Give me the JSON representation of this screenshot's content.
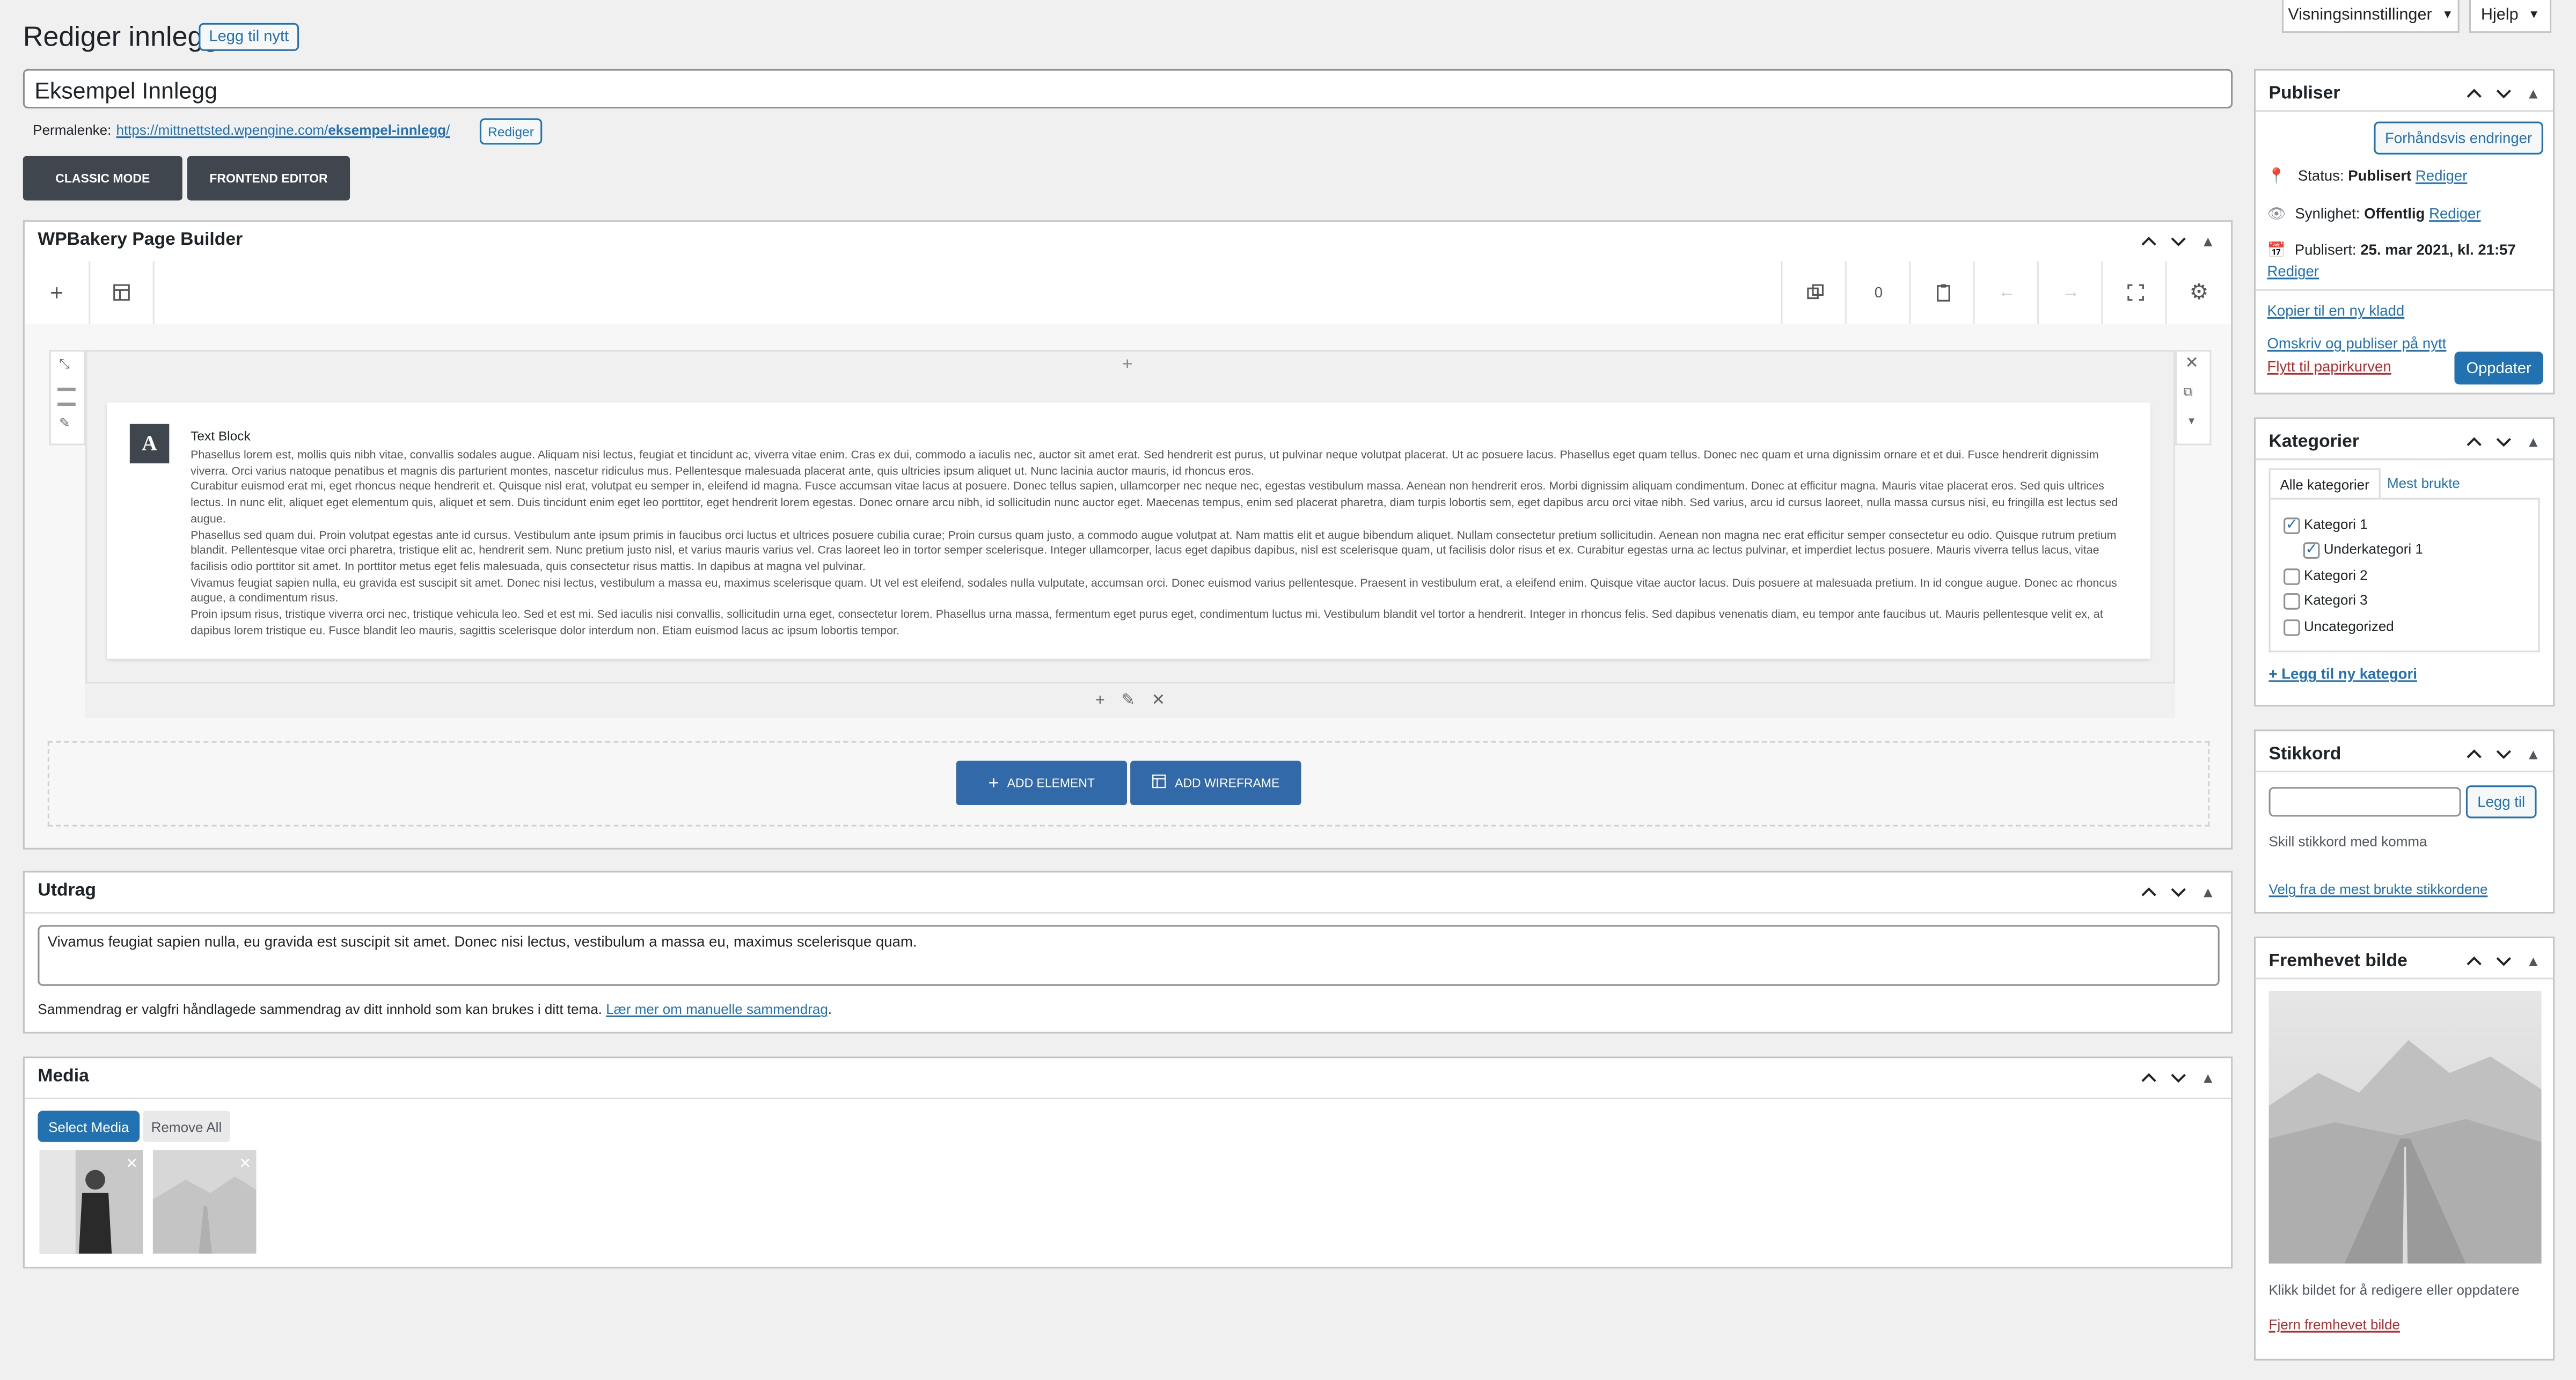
{
  "header": {
    "title": "Rediger innlegg",
    "add_new": "Legg til nytt",
    "screen_options": "Visningsinnstillinger",
    "help": "Hjelp"
  },
  "post": {
    "title": "Eksempel Innlegg",
    "permalink_label": "Permalenke:",
    "permalink_base": "https://mittnettsted.wpengine.com/",
    "permalink_slug": "eksempel-innlegg",
    "permalink_end": "/",
    "permalink_edit": "Rediger"
  },
  "mode_buttons": {
    "classic": "CLASSIC MODE",
    "frontend": "FRONTEND EDITOR"
  },
  "wpbakery": {
    "title": "WPBakery Page Builder",
    "undo_count": "0",
    "text_block_title": "Text Block",
    "text_block_icon": "A",
    "paragraphs": [
      "Phasellus lorem est, mollis quis nibh vitae, convallis sodales augue. Aliquam nisi lectus, feugiat et tincidunt ac, viverra vitae enim. Cras ex dui, commodo a iaculis nec, auctor sit amet erat. Sed hendrerit est purus, ut pulvinar neque volutpat placerat. Ut ac posuere lacus. Phasellus eget quam tellus. Donec nec quam et urna dignissim ornare et et dui. Fusce hendrerit dignissim viverra. Orci varius natoque penatibus et magnis dis parturient montes, nascetur ridiculus mus. Pellentesque malesuada placerat ante, quis ultricies ipsum aliquet ut. Nunc lacinia auctor mauris, id rhoncus eros.",
      "Curabitur euismod erat mi, eget rhoncus neque hendrerit et. Quisque nisl erat, volutpat eu semper in, eleifend id magna. Fusce accumsan vitae lacus at posuere. Donec tellus sapien, ullamcorper nec neque nec, egestas vestibulum massa. Aenean non hendrerit eros. Morbi dignissim aliquam condimentum. Donec at efficitur magna. Mauris vitae placerat eros. Sed quis ultrices lectus. In nunc elit, aliquet eget elementum quis, aliquet et sem. Duis tincidunt enim eget leo porttitor, eget hendrerit lorem egestas. Donec ornare arcu nibh, id sollicitudin nunc auctor eget. Maecenas tempus, enim sed placerat pharetra, diam turpis lobortis sem, eget dapibus arcu orci vitae nibh. Sed varius, arcu id cursus laoreet, nulla massa cursus nisi, eu fringilla est lectus sed augue.",
      "Phasellus sed quam dui. Proin volutpat egestas ante id cursus. Vestibulum ante ipsum primis in faucibus orci luctus et ultrices posuere cubilia curae; Proin cursus quam justo, a commodo augue volutpat at. Nam mattis elit et augue bibendum aliquet. Nullam consectetur pretium sollicitudin. Aenean non magna nec erat efficitur semper consectetur eu odio. Quisque rutrum pretium blandit. Pellentesque vitae orci pharetra, tristique elit ac, hendrerit sem. Nunc pretium justo nisl, et varius mauris varius vel. Cras laoreet leo in tortor semper scelerisque. Integer ullamcorper, lacus eget dapibus dapibus, nisl est scelerisque quam, ut facilisis dolor risus et ex. Curabitur egestas urna ac lectus pulvinar, et imperdiet lectus posuere. Mauris viverra tellus lacus, vitae facilisis odio porttitor sit amet. In porttitor metus eget felis malesuada, quis consectetur risus mattis. In dapibus at magna vel pulvinar.",
      "Vivamus feugiat sapien nulla, eu gravida est suscipit sit amet. Donec nisi lectus, vestibulum a massa eu, maximus scelerisque quam. Ut vel est eleifend, sodales nulla vulputate, accumsan orci. Donec euismod varius pellentesque. Praesent in vestibulum erat, a eleifend enim. Quisque vitae auctor lacus. Duis posuere at malesuada pretium. In id congue augue. Donec ac rhoncus augue, a condimentum risus.",
      "Proin ipsum risus, tristique viverra orci nec, tristique vehicula leo. Sed et est mi. Sed iaculis nisi convallis, sollicitudin urna eget, consectetur lorem. Phasellus urna massa, fermentum eget purus eget, condimentum luctus mi. Vestibulum blandit vel tortor a hendrerit. Integer in rhoncus felis. Sed dapibus venenatis diam, eu tempor ante faucibus ut. Mauris pellentesque velit ex, at dapibus lorem tristique eu. Fusce blandit leo mauris, sagittis scelerisque dolor interdum non. Etiam euismod lacus ac ipsum lobortis tempor."
    ],
    "add_element": "ADD ELEMENT",
    "add_wireframe": "ADD WIREFRAME"
  },
  "excerpt": {
    "title": "Utdrag",
    "value": "Vivamus feugiat sapien nulla, eu gravida est suscipit sit amet. Donec nisi lectus, vestibulum a massa eu, maximus scelerisque quam.",
    "help_text": "Sammendrag er valgfri håndlagede sammendrag av ditt innhold som kan brukes i ditt tema.",
    "help_link": "Lær mer om manuelle sammendrag",
    "help_end": "."
  },
  "media": {
    "title": "Media",
    "select": "Select Media",
    "remove_all": "Remove All"
  },
  "publish": {
    "title": "Publiser",
    "preview": "Forhåndsvis endringer",
    "status_label": "Status:",
    "status_value": "Publisert",
    "visibility_label": "Synlighet:",
    "visibility_value": "Offentlig",
    "published_label": "Publisert:",
    "published_value": "25. mar 2021, kl. 21:57",
    "edit": "Rediger",
    "copy_draft": "Kopier til en ny kladd",
    "rewrite": "Omskriv og publiser på nytt",
    "trash": "Flytt til papirkurven",
    "update": "Oppdater"
  },
  "categories": {
    "title": "Kategorier",
    "tab_all": "Alle kategorier",
    "tab_most": "Mest brukte",
    "items": [
      {
        "label": "Kategori 1",
        "checked": true
      },
      {
        "label": "Underkategori 1",
        "checked": true
      },
      {
        "label": "Kategori 2",
        "checked": false
      },
      {
        "label": "Kategori 3",
        "checked": false
      },
      {
        "label": "Uncategorized",
        "checked": false
      }
    ],
    "add_new": "+ Legg til ny kategori"
  },
  "tags": {
    "title": "Stikkord",
    "add": "Legg til",
    "hint": "Skill stikkord med komma",
    "choose": "Velg fra de mest brukte stikkordene"
  },
  "featured": {
    "title": "Fremhevet bilde",
    "hint": "Klikk bildet for å redigere eller oppdatere",
    "remove": "Fjern fremhevet bilde"
  }
}
